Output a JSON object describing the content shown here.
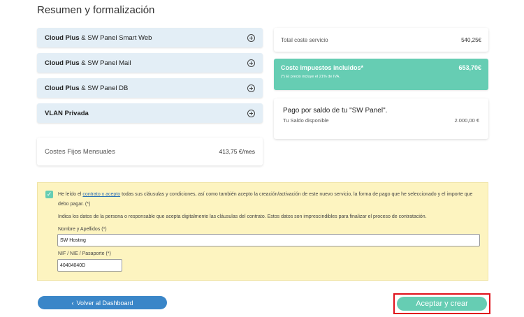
{
  "page_title": "Resumen y formalización",
  "services": [
    {
      "bold": "Cloud Plus",
      "rest": " & SW Panel Smart Web"
    },
    {
      "bold": "Cloud Plus",
      "rest": " & SW Panel Mail"
    },
    {
      "bold": "Cloud Plus",
      "rest": " & SW Panel DB"
    },
    {
      "bold": "VLAN Privada",
      "rest": ""
    }
  ],
  "fixed_costs": {
    "label": "Costes Fijos Mensuales",
    "amount": "413,75",
    "unit": "€/mes"
  },
  "total": {
    "label": "Total coste servicio",
    "amount": "540,25€"
  },
  "taxes": {
    "label": "Coste impuestos incluidos*",
    "amount": "653,70€",
    "note": "(*) El precio incluye el 21% de IVA."
  },
  "saldo": {
    "title": "Pago por saldo de tu \"SW Panel\".",
    "label": "Tu Saldo disponible",
    "amount": "2.000,00 €"
  },
  "legal": {
    "text_before": "He leído el ",
    "link": "contrato y acepto",
    "text_after": " todas sus cláusulas y condiciones, así como también acepto la creación/activación de este nuevo servicio, la forma de pago que he seleccionado y el importe que debo pagar.  (*)",
    "instructions": "Indica los datos de la persona o responsable que acepta digitalmente las cláusulas del contrato. Estos datos son imprescindibles para finalizar el proceso de contratación.",
    "name_label": "Nombre y Apellidos (*)",
    "name_value": "SW Hosting",
    "nif_label": "NIF / NIE / Pasaporte (*)",
    "nif_value": "40404040D"
  },
  "buttons": {
    "back": "Volver al Dashboard",
    "back_glyph": "‹",
    "accept": "Aceptar y crear",
    "check_glyph": "✓"
  }
}
